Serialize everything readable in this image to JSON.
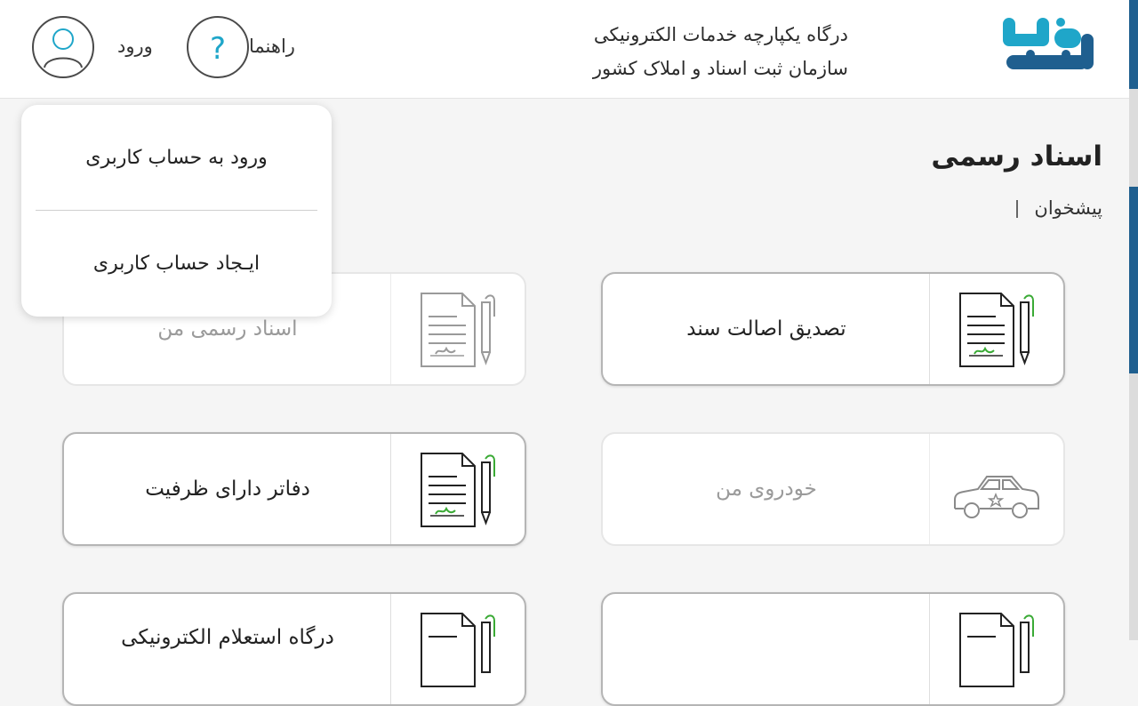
{
  "header": {
    "logo_alt": "ثبت من",
    "title_line1": "درگاه یکپارچه خدمات الکترونیکی",
    "title_line2": "سازمان ثبت اسناد و املاک کشور",
    "help_label": "راهنما",
    "login_label": "ورود"
  },
  "page": {
    "title": "اسناد رسمی",
    "breadcrumb": "پیشخوان"
  },
  "dropdown": {
    "login_account": "ورود به حساب کاربری",
    "create_account": "ایـجاد حساب کاربری"
  },
  "cards": [
    {
      "label": "تصدیق اصالت سند",
      "icon": "signed-document-icon",
      "enabled": true
    },
    {
      "label": "اسناد رسمی من",
      "icon": "signed-document-icon",
      "enabled": false
    },
    {
      "label": "خودروی من",
      "icon": "car-icon",
      "enabled": false
    },
    {
      "label": "دفاتر دارای ظرفیت",
      "icon": "signed-document-icon",
      "enabled": true
    },
    {
      "label": "",
      "icon": "signed-document-icon",
      "enabled": true
    },
    {
      "label": "درگاه استعلام الکترونیکی",
      "icon": "signed-document-icon",
      "enabled": true
    }
  ],
  "colors": {
    "accent_teal": "#1fa6c9",
    "logo_blue": "#1f5f8f",
    "pen_green": "#3aaa35"
  }
}
